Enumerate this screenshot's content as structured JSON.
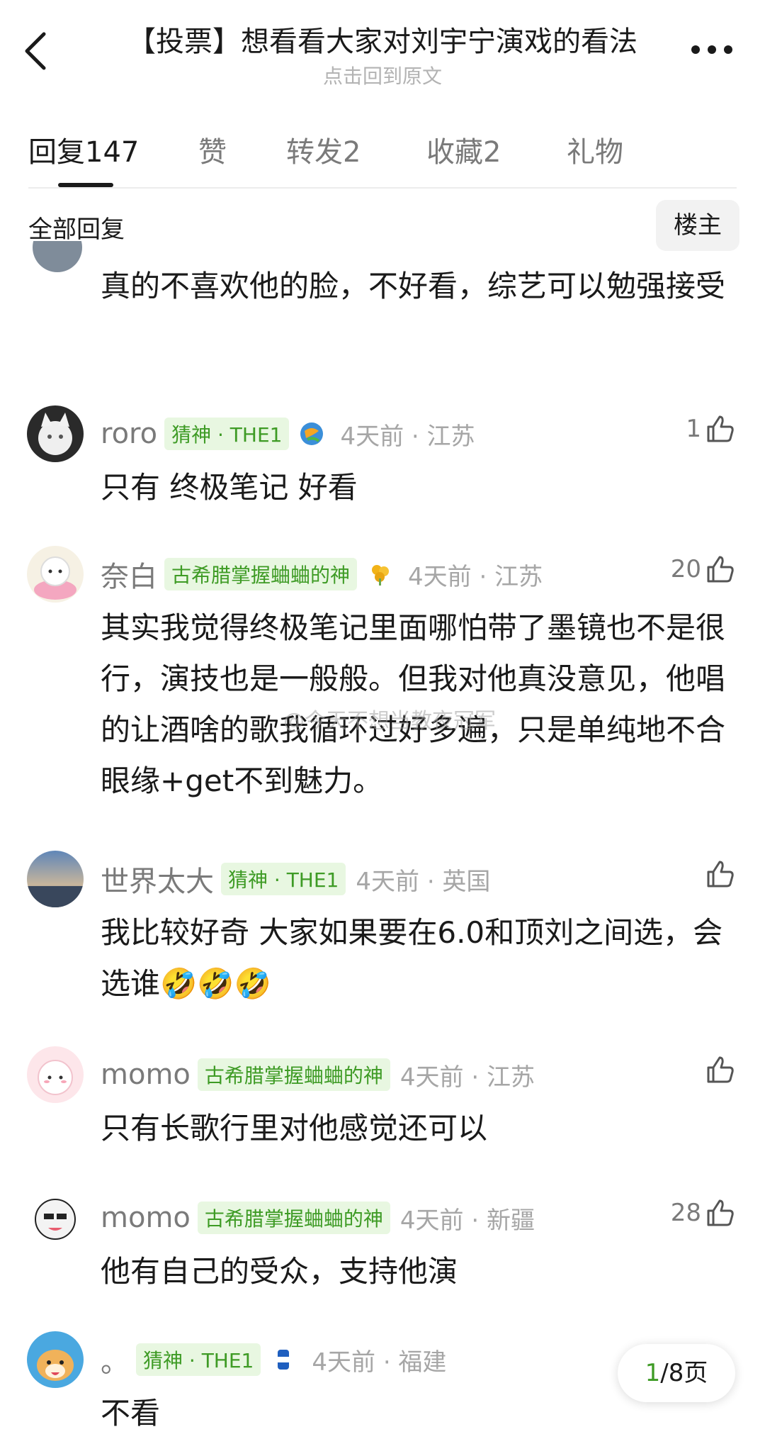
{
  "nav": {
    "title": "【投票】想看看大家对刘宇宁演戏的看法",
    "subtitle": "点击回到原文"
  },
  "tabs": [
    {
      "label": "回复",
      "count": "147"
    },
    {
      "label": "赞",
      "count": ""
    },
    {
      "label": "转发",
      "count": "2"
    },
    {
      "label": "收藏",
      "count": "2"
    },
    {
      "label": "礼物",
      "count": ""
    }
  ],
  "filter": {
    "label": "全部回复",
    "op_button": "楼主"
  },
  "previous_comment": {
    "text": "真的不喜欢他的脸，不好看，综艺可以勉强接受"
  },
  "comments": [
    {
      "name": "roro",
      "badge": "猜神 · THE1",
      "time": "4天前 · 江苏",
      "likes": "1",
      "text": "只有 终极笔记 好看"
    },
    {
      "name": "奈白",
      "badge": "古希腊掌握蛐蛐的神",
      "time": "4天前 · 江苏",
      "likes": "20",
      "text": "其实我觉得终极笔记里面哪怕带了墨镜也不是很行，演技也是一般般。但我对他真没意见，他唱的让酒啥的歌我循环过好多遍，只是单纯地不合眼缘+get不到魅力。"
    },
    {
      "name": "世界太大",
      "badge": "猜神 · THE1",
      "time": "4天前 · 英国",
      "likes": "",
      "text": "我比较好奇 大家如果要在6.0和顶刘之间选，会选谁🤣🤣🤣"
    },
    {
      "name": "momo",
      "badge": "古希腊掌握蛐蛐的神",
      "time": "4天前 · 江苏",
      "likes": "",
      "text": "只有长歌行里对他感觉还可以"
    },
    {
      "name": "momo",
      "badge": "古希腊掌握蛐蛐的神",
      "time": "4天前 · 新疆",
      "likes": "28",
      "text": "他有自己的受众，支持他演"
    },
    {
      "name": "。",
      "badge": "猜神 · THE1",
      "time": "4天前 · 福建",
      "likes": "",
      "text": "不看"
    }
  ],
  "watermark": "@今天不想当教夜冠军",
  "pager": {
    "current": "1",
    "total": "/8页"
  },
  "colors": {
    "badge_bg": "#e8f7e1",
    "badge_text": "#3e9b25",
    "meta_gray": "#a6a6a6"
  },
  "icons": [
    "back-icon",
    "more-icon",
    "thumbs-up-icon"
  ]
}
